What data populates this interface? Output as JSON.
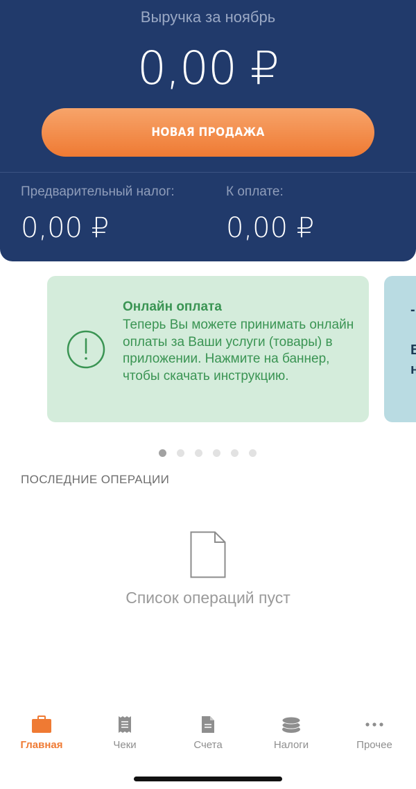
{
  "header": {
    "revenue_label": "Выручка за ноябрь",
    "revenue_value": "0,00 ₽",
    "new_sale_label": "НОВАЯ ПРОДАЖА",
    "tax_label": "Предварительный налог:",
    "tax_value": "0,00 ₽",
    "pay_label": "К оплате:",
    "pay_value": "0,00 ₽"
  },
  "banner": {
    "title": "Онлайн оплата",
    "text": "Теперь Вы можете принимать онлайн оплаты за Ваши услуги (товары) в приложении. Нажмите на баннер, чтобы скачать инструкцию.",
    "next_peek_lines": [
      "-",
      "В",
      "н"
    ]
  },
  "pager": {
    "count": 6,
    "active": 0
  },
  "operations": {
    "title": "ПОСЛЕДНИЕ ОПЕРАЦИИ",
    "empty_text": "Список операций пуст"
  },
  "tabs": [
    {
      "label": "Главная",
      "icon": "briefcase-icon",
      "active": true
    },
    {
      "label": "Чеки",
      "icon": "receipt-icon",
      "active": false
    },
    {
      "label": "Счета",
      "icon": "document-icon",
      "active": false
    },
    {
      "label": "Налоги",
      "icon": "coins-icon",
      "active": false
    },
    {
      "label": "Прочее",
      "icon": "more-dots-icon",
      "active": false
    }
  ],
  "colors": {
    "header_bg": "#213a6b",
    "accent": "#ef7a33",
    "banner_bg": "#d4ecdb",
    "banner_text": "#3a9453"
  }
}
